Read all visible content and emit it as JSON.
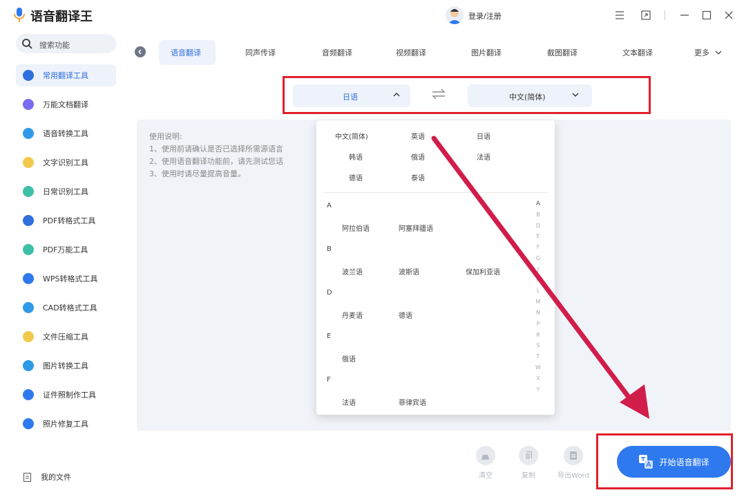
{
  "app": {
    "title": "语音翻译王",
    "login": "登录/注册"
  },
  "sidebar": {
    "search_label": "搜索功能",
    "items": [
      {
        "label": "常用翻译工具",
        "icon": "translate-icon",
        "color": "#2f6fe0"
      },
      {
        "label": "万能文档翻译",
        "icon": "document-icon",
        "color": "#7a6cf0"
      },
      {
        "label": "语音转换工具",
        "icon": "audio-icon",
        "color": "#2f9be8"
      },
      {
        "label": "文字识别工具",
        "icon": "text-ocr-icon",
        "color": "#f2c94c"
      },
      {
        "label": "日常识别工具",
        "icon": "scan-icon",
        "color": "#3ec0a8"
      },
      {
        "label": "PDF转格式工具",
        "icon": "pdf-convert-icon",
        "color": "#2f6fe0"
      },
      {
        "label": "PDF万能工具",
        "icon": "pdf-tools-icon",
        "color": "#3ec0a8"
      },
      {
        "label": "WPS转格式工具",
        "icon": "wps-icon",
        "color": "#2f79ee"
      },
      {
        "label": "CAD转格式工具",
        "icon": "cad-icon",
        "color": "#2f9be8"
      },
      {
        "label": "文件压缩工具",
        "icon": "compress-icon",
        "color": "#f2c94c"
      },
      {
        "label": "图片转换工具",
        "icon": "image-icon",
        "color": "#2f9be8"
      },
      {
        "label": "证件照制作工具",
        "icon": "id-photo-icon",
        "color": "#2f79ee"
      },
      {
        "label": "照片修复工具",
        "icon": "photo-repair-icon",
        "color": "#2f79ee"
      }
    ],
    "my_files": "我的文件"
  },
  "tabs": [
    "语音翻译",
    "同声传译",
    "音频翻译",
    "视频翻译",
    "图片翻译",
    "截图翻译",
    "文本翻译",
    "更多"
  ],
  "lang": {
    "from": "日语",
    "to": "中文(简体)"
  },
  "instructions": {
    "title": "使用说明:",
    "lines": [
      "1、使用前请确认是否已选择所需源语言",
      "2、使用语音翻译功能前，请先测试您话",
      "3、使用时请尽量提高音量。"
    ]
  },
  "dropdown": {
    "common": [
      [
        "中文(简体)",
        "英语",
        "日语"
      ],
      [
        "韩语",
        "俄语",
        "法语"
      ],
      [
        "德语",
        "泰语"
      ]
    ],
    "groups": [
      {
        "letter": "A",
        "items": [
          "阿拉伯语",
          "阿塞拜疆语"
        ]
      },
      {
        "letter": "B",
        "items": [
          "波兰语",
          "波斯语",
          "保加利亚语"
        ]
      },
      {
        "letter": "D",
        "items": [
          "丹麦语",
          "德语"
        ]
      },
      {
        "letter": "E",
        "items": [
          "俄语"
        ]
      },
      {
        "letter": "F",
        "items": [
          "法语",
          "菲律宾语"
        ]
      }
    ],
    "alphabet": [
      "A",
      "B",
      "D",
      "E",
      "F",
      "G",
      "J",
      "K",
      "L",
      "M",
      "N",
      "P",
      "R",
      "S",
      "T",
      "W",
      "X",
      "Y"
    ]
  },
  "actions": {
    "clear": "清空",
    "copy": "复制",
    "export": "导出Word",
    "start": "开始语音翻译"
  },
  "colors": {
    "accent": "#2f79ee",
    "highlight": "#e0202c"
  }
}
